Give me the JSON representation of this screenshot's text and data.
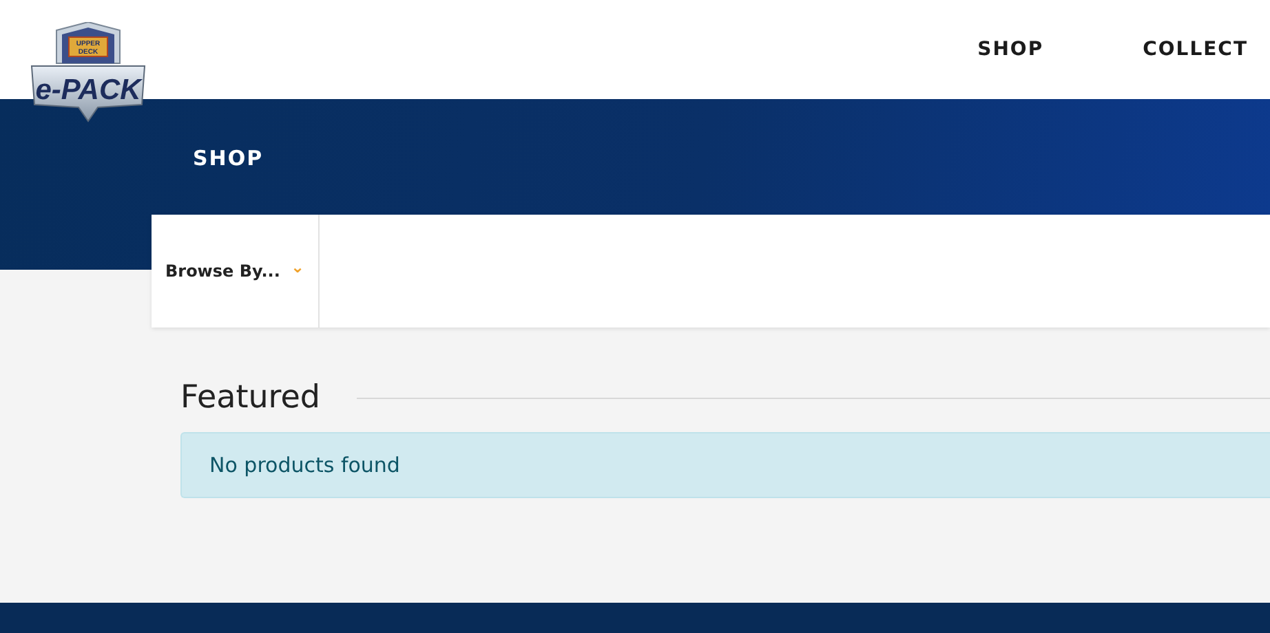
{
  "logo": {
    "badge_text": "UPPER DECK",
    "wordmark": "e-PACK"
  },
  "nav": [
    {
      "label": "SHOP"
    },
    {
      "label": "COLLECT"
    }
  ],
  "page_title": "SHOP",
  "filter": {
    "label": "Browse By...",
    "caret": "⌄"
  },
  "section": {
    "title": "Featured",
    "message": "No products found"
  }
}
